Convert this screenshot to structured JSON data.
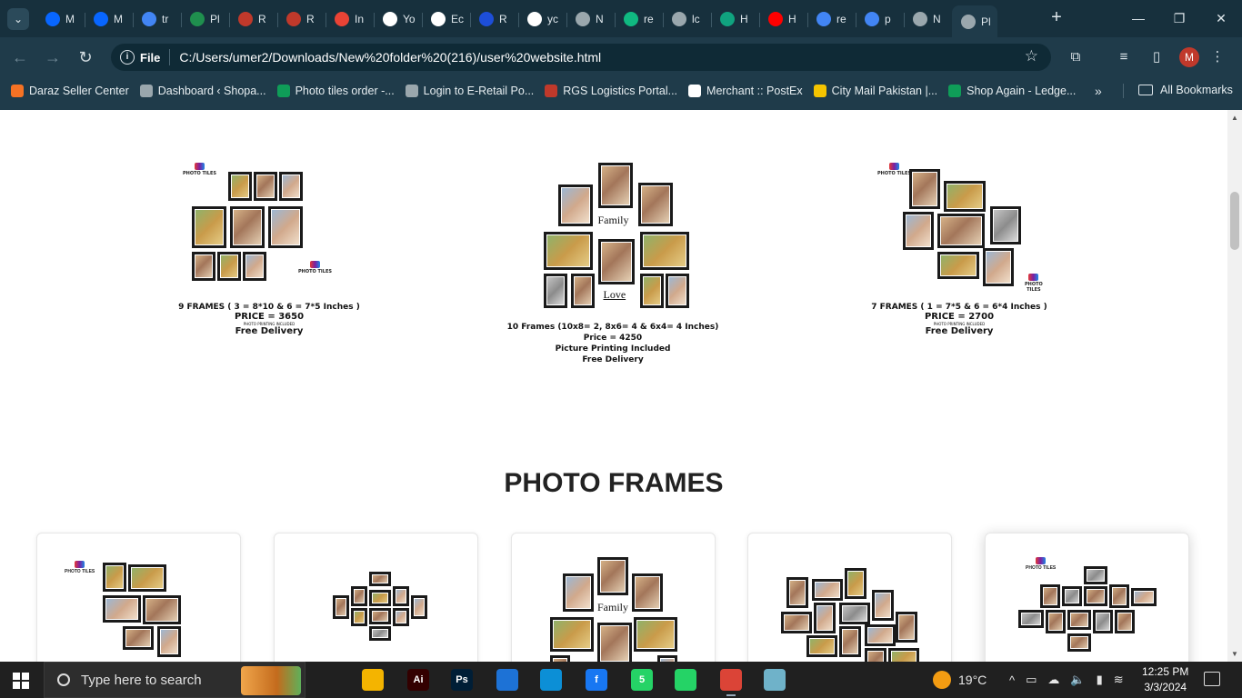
{
  "tabs": [
    {
      "label": "M",
      "icon": "meta-icon",
      "color": "#0866ff"
    },
    {
      "label": "M",
      "icon": "meta-icon",
      "color": "#0866ff"
    },
    {
      "label": "tr",
      "icon": "google-icon",
      "color": "#4285f4"
    },
    {
      "label": "Pl",
      "icon": "green-circle-icon",
      "color": "#1f8f4e"
    },
    {
      "label": "R",
      "icon": "rgs-cube-icon",
      "color": "#c0392b"
    },
    {
      "label": "R",
      "icon": "rgs-cube-icon",
      "color": "#c0392b"
    },
    {
      "label": "In",
      "icon": "gmail-icon",
      "color": "#ea4335"
    },
    {
      "label": "Yo",
      "icon": "github-icon",
      "color": "#ffffff"
    },
    {
      "label": "Ec",
      "icon": "github-icon",
      "color": "#ffffff"
    },
    {
      "label": "R",
      "icon": "d-icon",
      "color": "#1d4ed8"
    },
    {
      "label": "yc",
      "icon": "github-icon",
      "color": "#ffffff"
    },
    {
      "label": "N",
      "icon": "globe-icon",
      "color": "#9aa7ad"
    },
    {
      "label": "re",
      "icon": "green-square-icon",
      "color": "#10b981"
    },
    {
      "label": "lc",
      "icon": "globe-icon",
      "color": "#9aa7ad"
    },
    {
      "label": "H",
      "icon": "chatgpt-icon",
      "color": "#10a37f"
    },
    {
      "label": "H",
      "icon": "youtube-icon",
      "color": "#ff0000"
    },
    {
      "label": "re",
      "icon": "google-icon",
      "color": "#4285f4"
    },
    {
      "label": "p",
      "icon": "google-icon",
      "color": "#4285f4"
    },
    {
      "label": "N",
      "icon": "globe-icon",
      "color": "#9aa7ad"
    },
    {
      "label": "Pl",
      "icon": "page-icon",
      "color": "#9aa7ad",
      "active": true
    }
  ],
  "address": {
    "scheme": "File",
    "url": "C:/Users/umer2/Downloads/New%20folder%20(216)/user%20website.html"
  },
  "profile_initial": "M",
  "bookmarks": [
    {
      "label": "Daraz Seller Center",
      "icon": "daraz-icon",
      "color": "#f57224"
    },
    {
      "label": "Dashboard ‹ Shopa...",
      "icon": "globe-icon",
      "color": "#9aa7ad"
    },
    {
      "label": "Photo tiles order -...",
      "icon": "sheets-icon",
      "color": "#0f9d58"
    },
    {
      "label": "Login to E-Retail Po...",
      "icon": "globe-icon",
      "color": "#9aa7ad"
    },
    {
      "label": "RGS Logistics Portal...",
      "icon": "rgs-cube-icon",
      "color": "#c0392b"
    },
    {
      "label": "Merchant :: PostEx",
      "icon": "postex-icon",
      "color": "#ffffff"
    },
    {
      "label": "City Mail Pakistan |...",
      "icon": "citymail-icon",
      "color": "#f5c400"
    },
    {
      "label": "Shop Again - Ledge...",
      "icon": "sheets-icon",
      "color": "#0f9d58"
    }
  ],
  "all_bookmarks_label": "All Bookmarks",
  "products_top": [
    {
      "lines": [
        "9 FRAMES ( 3 = 8*10 & 6 = 7*5 Inches )",
        "PRICE = 3650",
        "PHOTO PRINTING INCLUDED",
        "Free Delivery"
      ],
      "logo_text": "PHOTO TILES"
    },
    {
      "lines": [
        "10 Frames (10x8= 2, 8x6= 4 & 6x4= 4 Inches)",
        "Price = 4250",
        "Picture Printing Included",
        "Free Delivery"
      ],
      "script_1": "Family",
      "script_2": "Love"
    },
    {
      "lines": [
        "7 FRAMES ( 1 = 7*5 & 6 = 6*4 Inches )",
        "PRICE = 2700",
        "PHOTO PRINTING INCLUDED",
        "Free Delivery"
      ],
      "logo_text": "PHOTO TILES"
    }
  ],
  "section_title": "PHOTO FRAMES",
  "cards": [
    {
      "logo_text": "PHOTO TILES"
    },
    {},
    {
      "script": "Family"
    },
    {},
    {
      "logo_text": "PHOTO TILES"
    }
  ],
  "taskbar": {
    "search_placeholder": "Type here to search",
    "apps": [
      {
        "name": "task-view-icon",
        "color": "#202020"
      },
      {
        "name": "file-explorer-icon",
        "color": "#f4b400"
      },
      {
        "name": "illustrator-icon",
        "label": "Ai",
        "color": "#330000"
      },
      {
        "name": "photoshop-icon",
        "label": "Ps",
        "color": "#001e36"
      },
      {
        "name": "edge-dev-icon",
        "color": "#1d72d6"
      },
      {
        "name": "edge-icon",
        "color": "#0c8fd6"
      },
      {
        "name": "facebook-icon",
        "label": "f",
        "color": "#1877f2"
      },
      {
        "name": "whatsapp-badge-icon",
        "label": "5",
        "color": "#25d366"
      },
      {
        "name": "whatsapp-icon",
        "color": "#25d366"
      },
      {
        "name": "chrome-icon",
        "color": "#db4437"
      },
      {
        "name": "notes-icon",
        "color": "#6fb2c9"
      }
    ],
    "weather": "19°C",
    "time": "12:25 PM",
    "date": "3/3/2024"
  }
}
